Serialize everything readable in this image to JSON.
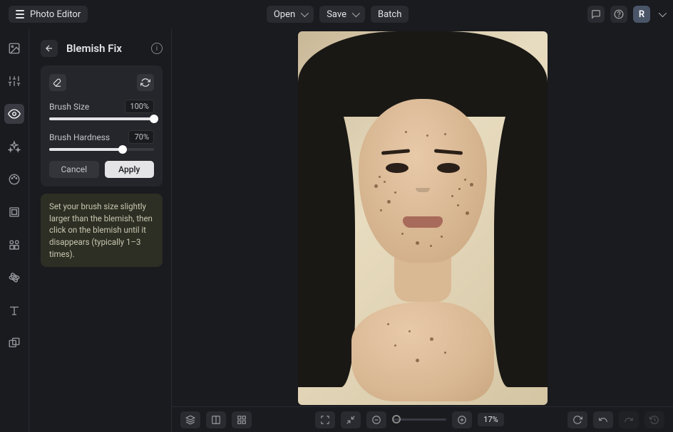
{
  "app": {
    "title": "Photo Editor"
  },
  "topbar": {
    "open": "Open",
    "save": "Save",
    "batch": "Batch",
    "avatar_initial": "R"
  },
  "panel": {
    "title": "Blemish Fix",
    "brush_size_label": "Brush Size",
    "brush_size_value": "100%",
    "brush_size_pct": 100,
    "brush_hardness_label": "Brush Hardness",
    "brush_hardness_value": "70%",
    "brush_hardness_pct": 70,
    "cancel": "Cancel",
    "apply": "Apply",
    "tip": "Set your brush size slightly larger than the blemish, then click on the blemish until it disappears (typically 1–3 times)."
  },
  "bottom": {
    "zoom": "17%"
  }
}
